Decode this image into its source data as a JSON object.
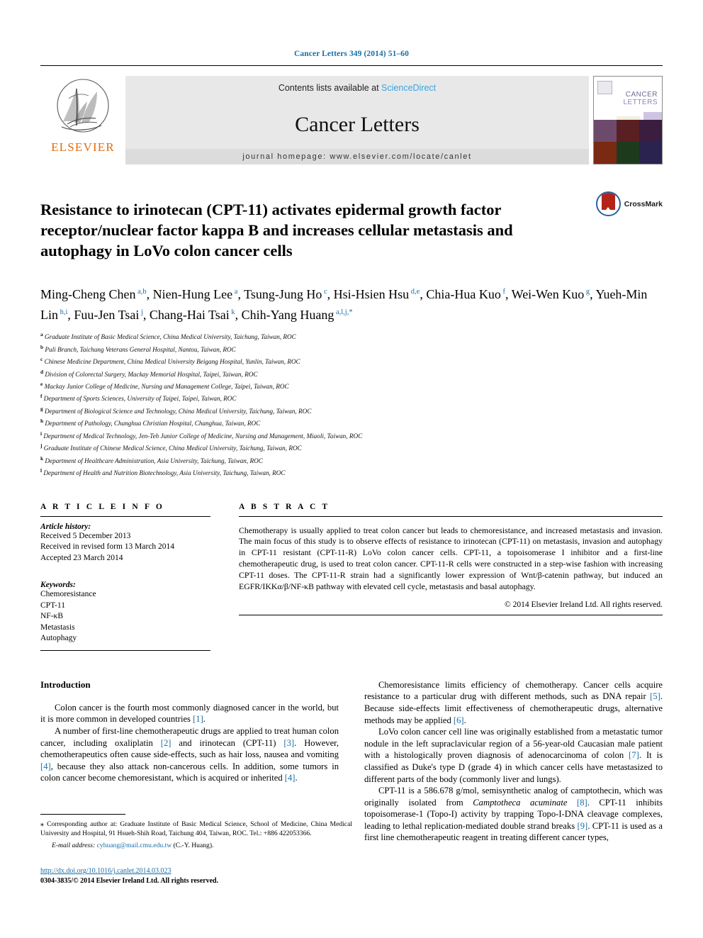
{
  "running_head": "Cancer Letters 349 (2014) 51–60",
  "masthead": {
    "contents_prefix": "Contents lists available at ",
    "sciencedirect": "ScienceDirect",
    "journal_name": "Cancer Letters",
    "homepage": "journal homepage: www.elsevier.com/locate/canlet",
    "publisher_logo_text": "ELSEVIER",
    "cover": {
      "title_line1": "CANCER",
      "title_line2": "LETTERS"
    }
  },
  "article": {
    "title": "Resistance to irinotecan (CPT-11) activates epidermal growth factor receptor/nuclear factor kappa B and increases cellular metastasis and autophagy in LoVo colon cancer cells",
    "crossmark_label": "CrossMark",
    "authors": [
      {
        "name": "Ming-Cheng Chen",
        "marks": "a,b",
        "sep": ", "
      },
      {
        "name": "Nien-Hung Lee",
        "marks": "a",
        "sep": ", "
      },
      {
        "name": "Tsung-Jung Ho",
        "marks": "c",
        "sep": ", "
      },
      {
        "name": "Hsi-Hsien Hsu",
        "marks": "d,e",
        "sep": ", "
      },
      {
        "name": "Chia-Hua Kuo",
        "marks": "f",
        "sep": ", "
      },
      {
        "name": "Wei-Wen Kuo",
        "marks": "g",
        "sep": ", "
      },
      {
        "name": "Yueh-Min Lin",
        "marks": "h,i",
        "sep": ", "
      },
      {
        "name": "Fuu-Jen Tsai",
        "marks": "j",
        "sep": ", "
      },
      {
        "name": "Chang-Hai Tsai",
        "marks": "k",
        "sep": ", "
      },
      {
        "name": "Chih-Yang Huang",
        "marks": "a,l,j,*",
        "sep": ""
      }
    ],
    "affiliations": [
      {
        "label": "a",
        "text": "Graduate Institute of Basic Medical Science, China Medical University, Taichung, Taiwan, ROC"
      },
      {
        "label": "b",
        "text": "Puli Branch, Taichung Veterans General Hospital, Nantou, Taiwan, ROC"
      },
      {
        "label": "c",
        "text": "Chinese Medicine Department, China Medical University Beigang Hospital, Yunlin, Taiwan, ROC"
      },
      {
        "label": "d",
        "text": "Division of Colorectal Surgery, Mackay Memorial Hospital, Taipei, Taiwan, ROC"
      },
      {
        "label": "e",
        "text": "Mackay Junior College of Medicine, Nursing and Management College, Taipei, Taiwan, ROC"
      },
      {
        "label": "f",
        "text": "Department of Sports Sciences, University of Taipei, Taipei, Taiwan, ROC"
      },
      {
        "label": "g",
        "text": "Department of Biological Science and Technology, China Medical University, Taichung, Taiwan, ROC"
      },
      {
        "label": "h",
        "text": "Department of Pathology, Changhua Christian Hospital, Changhua, Taiwan, ROC"
      },
      {
        "label": "i",
        "text": "Department of Medical Technology, Jen-Teh Junior College of Medicine, Nursing and Management, Miaoli, Taiwan, ROC"
      },
      {
        "label": "j",
        "text": "Graduate Institute of Chinese Medical Science, China Medical University, Taichung, Taiwan, ROC"
      },
      {
        "label": "k",
        "text": "Department of Healthcare Administration, Asia University, Taichung, Taiwan, ROC"
      },
      {
        "label": "l",
        "text": "Department of Health and Nutrition Biotechnology, Asia University, Taichung, Taiwan, ROC"
      }
    ]
  },
  "article_info": {
    "heading": "A R T I C L E   I N F O",
    "history_label": "Article history:",
    "history": [
      "Received 5 December 2013",
      "Received in revised form 13 March 2014",
      "Accepted 23 March 2014"
    ],
    "keywords_label": "Keywords:",
    "keywords": [
      "Chemoresistance",
      "CPT-11",
      "NF-κB",
      "Metastasis",
      "Autophagy"
    ]
  },
  "abstract": {
    "heading": "A B S T R A C T",
    "text": "Chemotherapy is usually applied to treat colon cancer but leads to chemoresistance, and increased metastasis and invasion. The main focus of this study is to observe effects of resistance to irinotecan (CPT-11) on metastasis, invasion and autophagy in CPT-11 resistant (CPT-11-R) LoVo colon cancer cells. CPT-11, a topoisomerase I inhibitor and a first-line chemotherapeutic drug, is used to treat colon cancer. CPT-11-R cells were constructed in a step-wise fashion with increasing CPT-11 doses. The CPT-11-R strain had a significantly lower expression of Wnt/β-catenin pathway, but induced an EGFR/IKKα/β/NF-κB pathway with elevated cell cycle, metastasis and basal autophagy.",
    "copyright": "© 2014 Elsevier Ireland Ltd. All rights reserved."
  },
  "introduction": {
    "heading": "Introduction",
    "left_paragraphs": [
      "Colon cancer is the fourth most commonly diagnosed cancer in the world, but it is more common in developed countries [1].",
      "A number of first-line chemotherapeutic drugs are applied to treat human colon cancer, including oxaliplatin [2] and irinotecan (CPT-11) [3]. However, chemotherapeutics often cause side-effects, such as hair loss, nausea and vomiting [4], because they also attack non-cancerous cells. In addition, some tumors in colon cancer become chemoresistant, which is acquired or inherited [4]."
    ],
    "right_paragraphs": [
      "Chemoresistance limits efficiency of chemotherapy. Cancer cells acquire resistance to a particular drug with different methods, such as DNA repair [5]. Because side-effects limit effectiveness of chemotherapeutic drugs, alternative methods may be applied [6].",
      "LoVo colon cancer cell line was originally established from a metastatic tumor nodule in the left supraclavicular region of a 56-year-old Caucasian male patient with a histologically proven diagnosis of adenocarcinoma of colon [7]. It is classified as Duke's type D (grade 4) in which cancer cells have metastasized to different parts of the body (commonly liver and lungs).",
      "CPT-11 is a 586.678 g/mol, semisynthetic analog of camptothecin, which was originally isolated from Camptotheca acuminate [8]. CPT-11 inhibits topoisomerase-1 (Topo-I) activity by trapping Topo-I-DNA cleavage complexes, leading to lethal replication-mediated double strand breaks [9]. CPT-11 is used as a first line chemotherapeutic reagent in treating different cancer types,"
    ]
  },
  "footnote": {
    "marker": "⁎",
    "text": "Corresponding author at: Graduate Institute of Basic Medical Science, School of Medicine, China Medical University and Hospital, 91 Hsueh-Shih Road, Taichung 404, Taiwan, ROC. Tel.: +886 422053366.",
    "email_label": "E-mail address:",
    "email": "cyhuang@mail.cmu.edu.tw",
    "email_suffix": "(C.-Y. Huang)."
  },
  "footer": {
    "doi": "http://dx.doi.org/10.1016/j.canlet.2014.03.023",
    "issn_line": "0304-3835/© 2014 Elsevier Ireland Ltd. All rights reserved."
  },
  "colors": {
    "link": "#1a6ea8",
    "sciencedirect": "#3aa3dd",
    "elsevier_orange": "#E46C0A",
    "crossmark_red": "#b42318",
    "crossmark_blue": "#2f5f9e"
  }
}
